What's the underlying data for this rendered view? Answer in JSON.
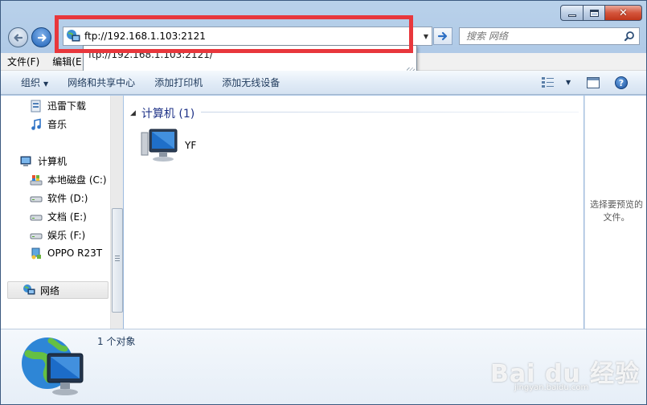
{
  "window": {
    "caption_buttons": {
      "minimize": "minimize",
      "maximize": "maximize",
      "close": "✕"
    }
  },
  "address": {
    "value": "ftp://192.168.1.103:2121",
    "autocomplete_suggestion": "ftp://192.168.1.103:2121/",
    "highlight_color": "#e8373c"
  },
  "search": {
    "placeholder": "搜索 网络"
  },
  "menubar": {
    "items": [
      "文件(F)",
      "编辑(E"
    ]
  },
  "commandbar": {
    "organize": "组织",
    "network_center": "网络和共享中心",
    "add_printer": "添加打印机",
    "add_wireless": "添加无线设备",
    "help": "?"
  },
  "navpane": {
    "items": [
      {
        "label": "迅雷下载",
        "icon": "download-folder-icon"
      },
      {
        "label": "音乐",
        "icon": "music-icon"
      },
      {
        "label": "计算机",
        "icon": "computer-icon"
      },
      {
        "label": "本地磁盘 (C:)",
        "icon": "system-drive-icon"
      },
      {
        "label": "软件 (D:)",
        "icon": "drive-icon"
      },
      {
        "label": "文档 (E:)",
        "icon": "drive-icon"
      },
      {
        "label": "娱乐 (F:)",
        "icon": "drive-icon"
      },
      {
        "label": "OPPO R23T",
        "icon": "phone-device-icon"
      },
      {
        "label": "网络",
        "icon": "network-icon",
        "selected": true
      }
    ]
  },
  "content": {
    "group_header": "计算机 (1)",
    "items": [
      {
        "label": "YF",
        "icon": "network-computer-icon"
      }
    ]
  },
  "preview": {
    "text": "选择要预览的文件。"
  },
  "details": {
    "count_text": "1 个对象"
  },
  "watermark": {
    "brand": "Bai du 经验",
    "url": "jingyan.baidu.com"
  }
}
